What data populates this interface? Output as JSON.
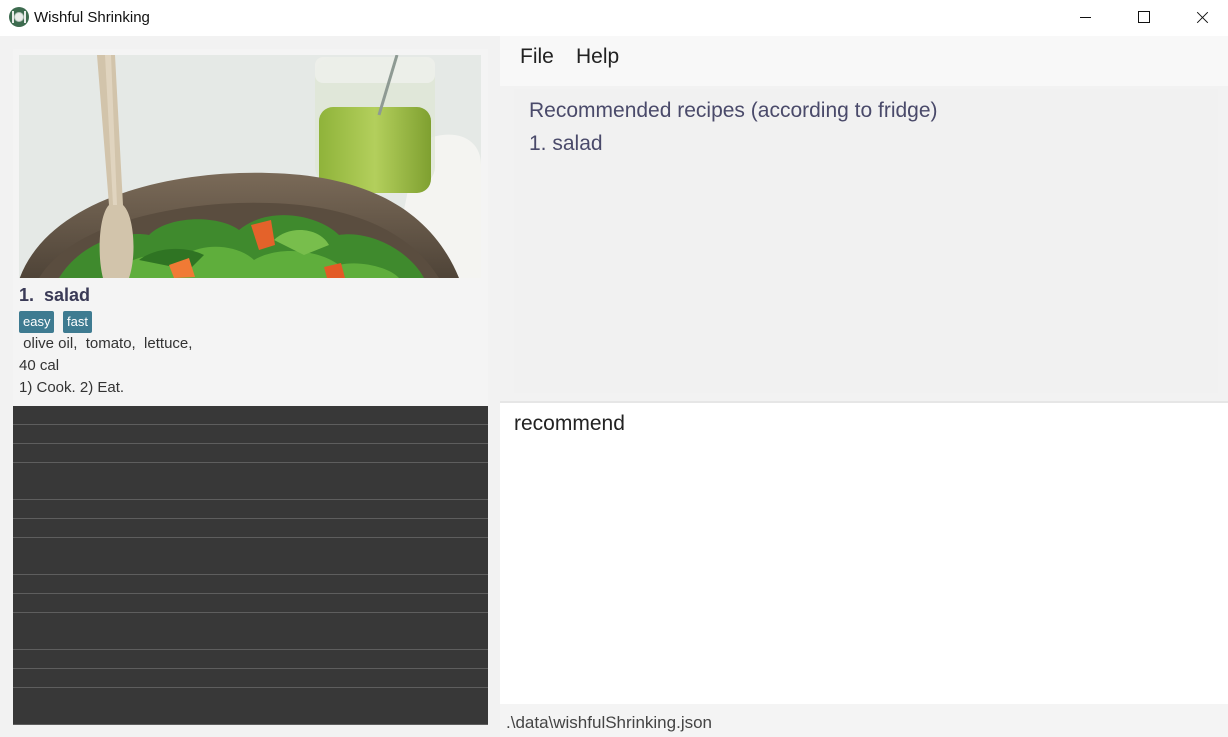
{
  "window": {
    "title": "Wishful Shrinking"
  },
  "menu": {
    "file": "File",
    "help": "Help"
  },
  "recipe_list": {
    "items": [
      {
        "index_name": "1.  salad",
        "tags": [
          "easy",
          "fast"
        ],
        "ingredients": " olive oil,  tomato,  lettuce,",
        "calories": "40 cal",
        "instructions": "1) Cook. 2) Eat."
      }
    ]
  },
  "result_display": {
    "title": "Recommended recipes (according to fridge)",
    "lines": [
      "1. salad"
    ]
  },
  "command_box": {
    "value": "recommend"
  },
  "status_bar": {
    "path": ".\\data\\wishfulShrinking.json"
  },
  "colors": {
    "tag_background": "#3e7b91",
    "list_background": "#383838",
    "result_text": "#4a4a6a"
  },
  "icons": {
    "app": "plate-icon",
    "minimize": "minimize-icon",
    "maximize": "maximize-icon",
    "close": "close-icon"
  }
}
